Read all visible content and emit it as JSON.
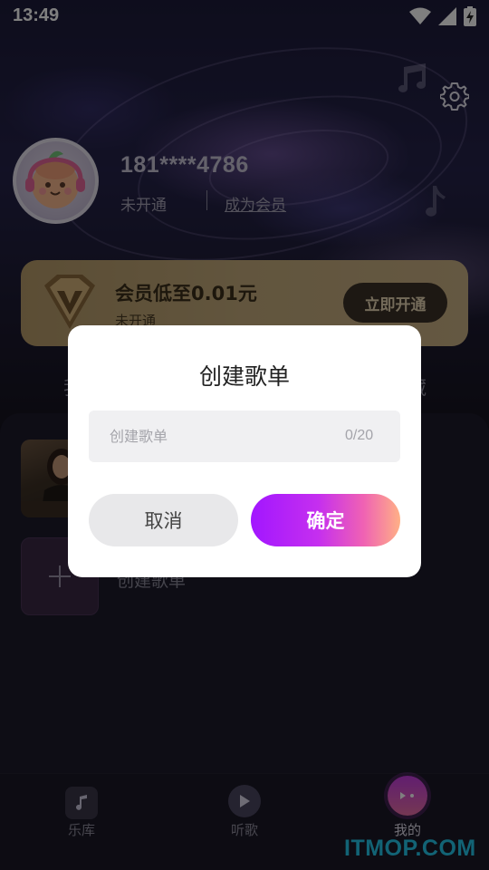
{
  "status_bar": {
    "time": "13:49",
    "icons": [
      "wifi-icon",
      "signal-icon",
      "battery-charging-icon"
    ]
  },
  "header": {
    "settings_icon": "gear-icon"
  },
  "profile": {
    "phone": "181****4786",
    "membership_status": "未开通",
    "become_member": "成为会员"
  },
  "vip_card": {
    "title": "会员低至0.01元",
    "subtitle": "未开通",
    "button": "立即开通"
  },
  "tabs_peek": {
    "left": "我",
    "right": "藏"
  },
  "playlists": {
    "create_label": "创建歌单"
  },
  "bottom_nav": {
    "items": [
      {
        "label": "乐库",
        "icon": "music-library-icon",
        "active": false
      },
      {
        "label": "听歌",
        "icon": "play-icon",
        "active": false
      },
      {
        "label": "我的",
        "icon": "profile-icon",
        "active": true
      }
    ]
  },
  "dialog": {
    "title": "创建歌单",
    "input_placeholder": "创建歌单",
    "input_value": "",
    "char_count": "0/20",
    "cancel": "取消",
    "confirm": "确定"
  },
  "watermark": "ITMOP.COM",
  "colors": {
    "accent_gradient_start": "#a216ff",
    "accent_gradient_end": "#ffb086",
    "vip_gold": "#c4ab7c",
    "watermark": "#25c7ea"
  }
}
